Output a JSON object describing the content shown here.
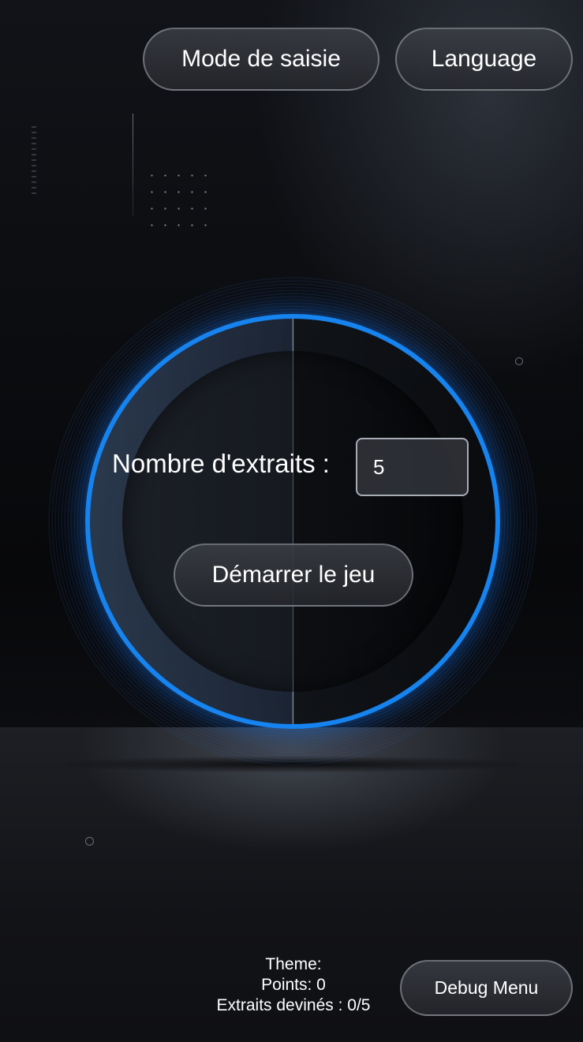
{
  "header": {
    "input_mode_label": "Mode de saisie",
    "language_label": "Language"
  },
  "game": {
    "count_label": "Nombre d'extraits :",
    "count_value": "5",
    "start_label": "Démarrer le jeu"
  },
  "stats": {
    "theme": "Theme:",
    "points": "Points: 0",
    "guessed": "Extraits devinés : 0/5"
  },
  "footer": {
    "debug_label": "Debug Menu"
  },
  "colors": {
    "ring_accent": "#1683ee",
    "background": "#0b0c0f"
  }
}
